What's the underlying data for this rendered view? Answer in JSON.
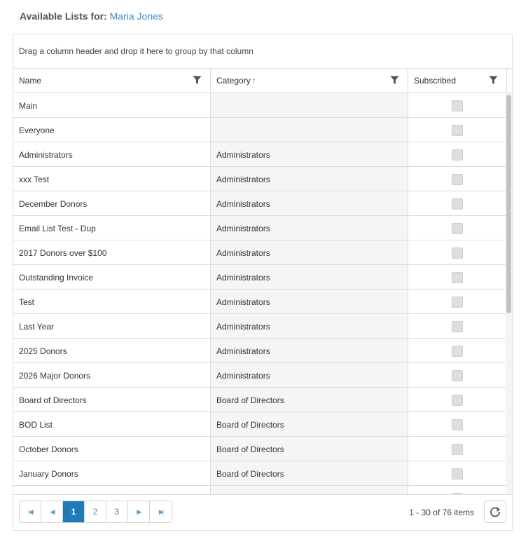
{
  "heading": {
    "label": "Available Lists for:",
    "user_name": "Maria Jones"
  },
  "grid": {
    "group_panel_text": "Drag a column header and drop it here to group by that column",
    "columns": [
      {
        "label": "Name",
        "filter_icon": "filter-icon"
      },
      {
        "label": "Category",
        "sort": "asc",
        "sort_glyph": "↑",
        "filter_icon": "filter-icon"
      },
      {
        "label": "Subscribed",
        "filter_icon": "filter-icon"
      }
    ],
    "rows": [
      {
        "name": "Main",
        "category": "",
        "subscribed": false
      },
      {
        "name": "Everyone",
        "category": "",
        "subscribed": false
      },
      {
        "name": "Administrators",
        "category": "Administrators",
        "subscribed": false
      },
      {
        "name": "xxx Test",
        "category": "Administrators",
        "subscribed": false
      },
      {
        "name": "December Donors",
        "category": "Administrators",
        "subscribed": false
      },
      {
        "name": "Email List Test - Dup",
        "category": "Administrators",
        "subscribed": false
      },
      {
        "name": "2017 Donors over $100",
        "category": "Administrators",
        "subscribed": false
      },
      {
        "name": "Outstanding Invoice",
        "category": "Administrators",
        "subscribed": false
      },
      {
        "name": "Test",
        "category": "Administrators",
        "subscribed": false
      },
      {
        "name": "Last Year",
        "category": "Administrators",
        "subscribed": false
      },
      {
        "name": "2025 Donors",
        "category": "Administrators",
        "subscribed": false
      },
      {
        "name": "2026 Major Donors",
        "category": "Administrators",
        "subscribed": false
      },
      {
        "name": "Board of Directors",
        "category": "Board of Directors",
        "subscribed": false
      },
      {
        "name": "BOD List",
        "category": "Board of Directors",
        "subscribed": false
      },
      {
        "name": "October Donors",
        "category": "Board of Directors",
        "subscribed": false
      },
      {
        "name": "January Donors",
        "category": "Board of Directors",
        "subscribed": false
      },
      {
        "name": "",
        "category": "",
        "subscribed": false
      }
    ]
  },
  "pager": {
    "first_icon": "first-page-icon",
    "prev_icon": "prev-page-icon",
    "next_icon": "next-page-icon",
    "last_icon": "last-page-icon",
    "pages": [
      "1",
      "2",
      "3"
    ],
    "current_page": "1",
    "info": "1 - 30 of 76 items",
    "refresh_icon": "refresh-icon"
  },
  "colors": {
    "accent": "#1f7ab5",
    "link": "#3e8ecc",
    "border": "#dcdcdc"
  }
}
